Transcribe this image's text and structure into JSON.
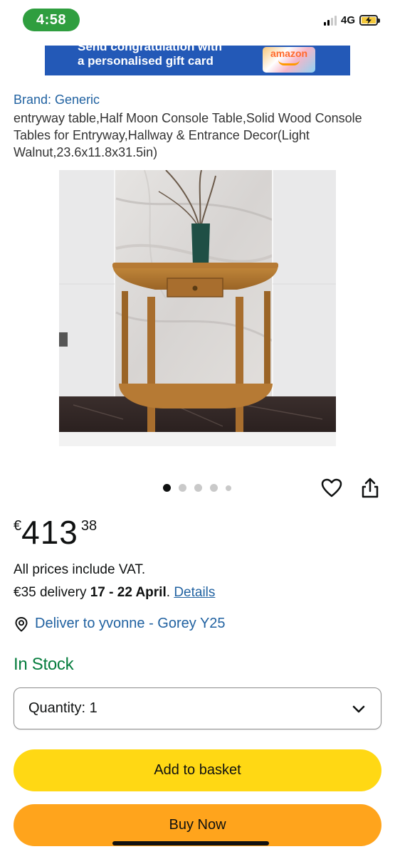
{
  "status_bar": {
    "time": "4:58",
    "network": "4G",
    "signal_icon": "signal-bars-icon",
    "battery_icon": "battery-charging-icon"
  },
  "banner": {
    "line1": "Send congratulation with",
    "line2": "a personalised gift card",
    "card_brand": "amazon"
  },
  "product": {
    "brand_text": "Brand: Generic",
    "title": "entryway table,Half Moon Console Table,Solid Wood Console Tables for Entryway,Hallway & Entrance Decor(Light Walnut,23.6x11.8x31.5in)",
    "image_icon": "half-moon-console-table-photo"
  },
  "carousel": {
    "image_count": 5,
    "active_index": 0
  },
  "price": {
    "currency_symbol": "€",
    "whole": "413",
    "fraction": "38"
  },
  "vat_note": "All prices include VAT.",
  "delivery": {
    "prefix": "€35 delivery ",
    "dates": "17 - 22 April",
    "suffix": ". ",
    "details_link": "Details"
  },
  "deliver_to": {
    "text": "Deliver to yvonne - Gorey Y25",
    "icon": "location-pin-icon"
  },
  "stock_status": "In Stock",
  "quantity": {
    "label": "Quantity:",
    "value": "1"
  },
  "buttons": {
    "add_to_basket": "Add to basket",
    "buy_now": "Buy Now"
  },
  "colors": {
    "link_blue": "#2162a1",
    "stock_green": "#067d3e",
    "add_button": "#ffd814",
    "buy_button": "#ffa41c",
    "banner_blue": "#2359b7",
    "time_pill": "#2f9e3f"
  }
}
